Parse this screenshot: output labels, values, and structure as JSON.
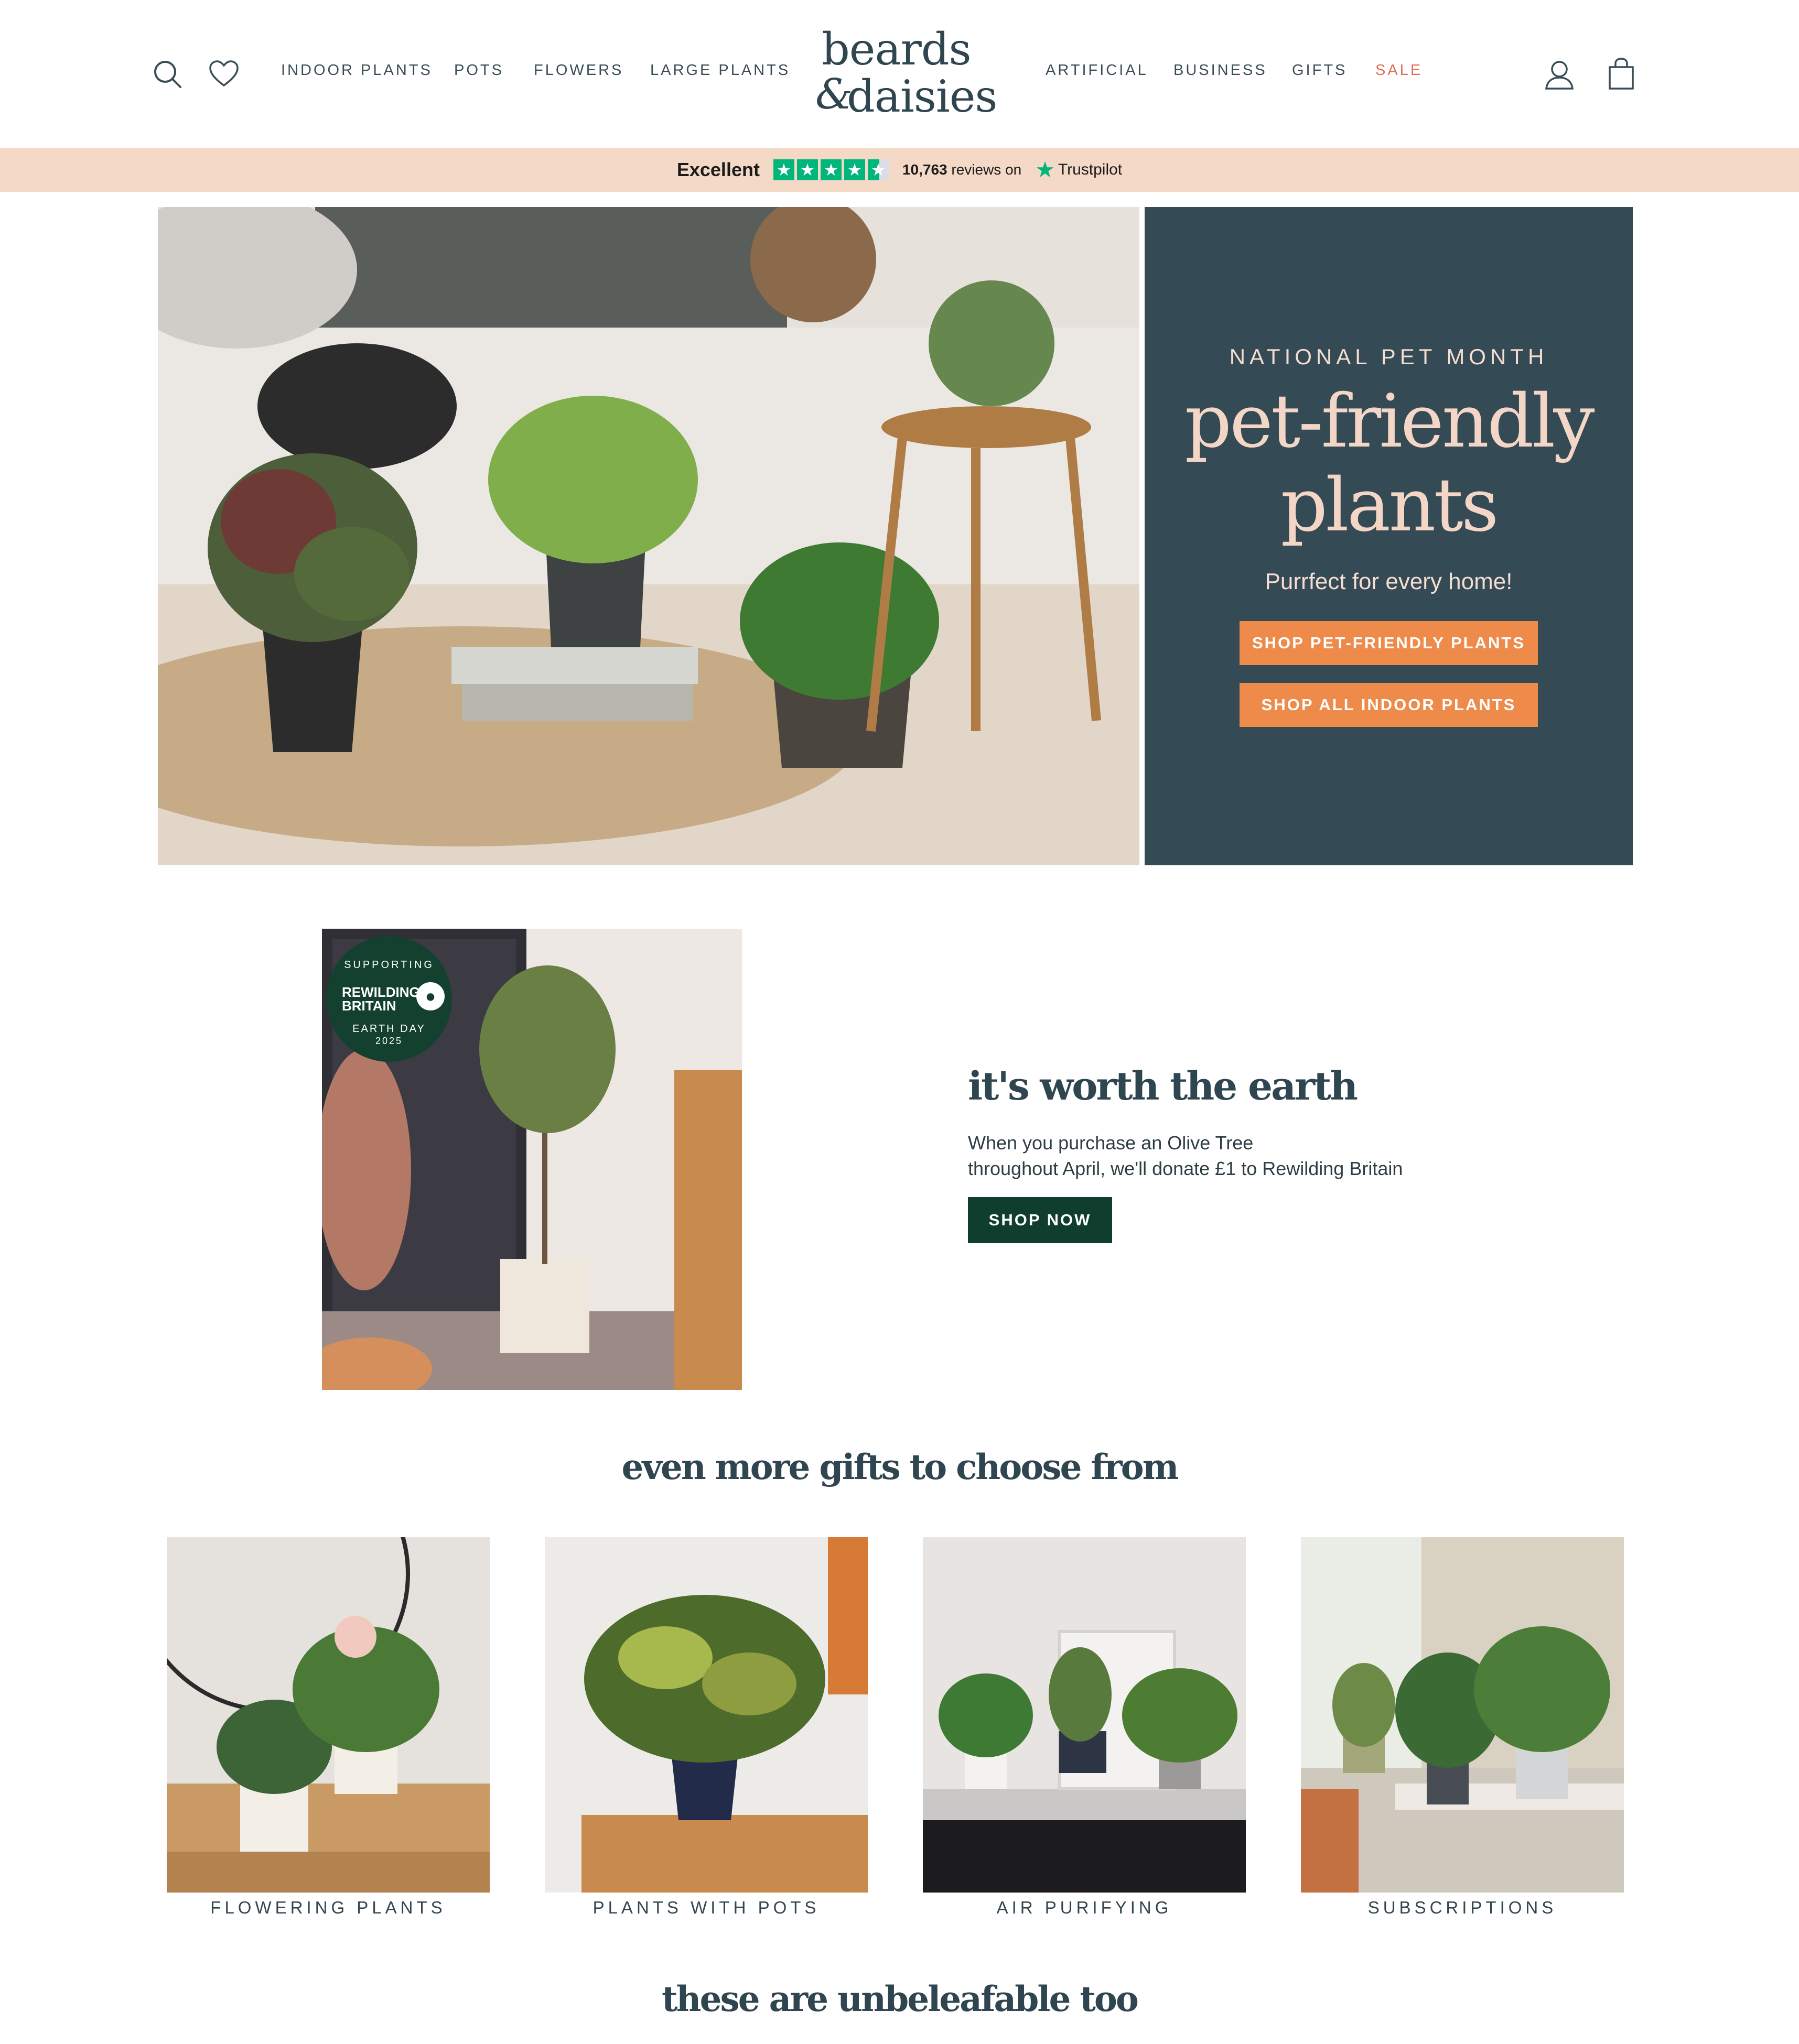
{
  "header": {
    "logo": {
      "line1": "beards",
      "amp": "&",
      "line2": "daisies"
    },
    "nav_left": [
      "INDOOR PLANTS",
      "POTS",
      "FLOWERS",
      "LARGE PLANTS"
    ],
    "nav_right": [
      "ARTIFICIAL",
      "BUSINESS",
      "GIFTS",
      "SALE"
    ],
    "icons": [
      "search-icon",
      "heart-icon",
      "account-icon",
      "bag-icon"
    ]
  },
  "trustbar": {
    "rating": "Excellent",
    "stars": 4.5,
    "reviews_count": "10,763",
    "reviews_text": "reviews on",
    "brand": "Trustpilot",
    "brand_color": "#00b67a"
  },
  "hero": {
    "eyebrow": "NATIONAL PET MONTH",
    "title_line1": "pet-friendly",
    "title_line2": "plants",
    "subtitle": "Purrfect for every home!",
    "button1": "SHOP PET-FRIENDLY PLANTS",
    "button2": "SHOP ALL INDOOR PLANTS",
    "panel_color": "#344a55",
    "button_color": "#ee8b4b"
  },
  "earth": {
    "badge": {
      "top": "SUPPORTING",
      "name_line1": "REWILDING",
      "name_line2": "BRITAIN",
      "event": "EARTH DAY",
      "year": "2025"
    },
    "title": "it's worth the earth",
    "text_line1": "When you purchase an Olive Tree",
    "text_line2": "throughout April, we'll donate £1 to Rewilding Britain",
    "button": "SHOP NOW",
    "button_color": "#0f3d2e"
  },
  "gifts": {
    "title": "even more gifts to choose from",
    "categories": [
      "FLOWERING PLANTS",
      "PLANTS WITH POTS",
      "AIR PURIFYING",
      "SUBSCRIPTIONS"
    ]
  },
  "more": {
    "title": "these are unbeleafable too"
  }
}
